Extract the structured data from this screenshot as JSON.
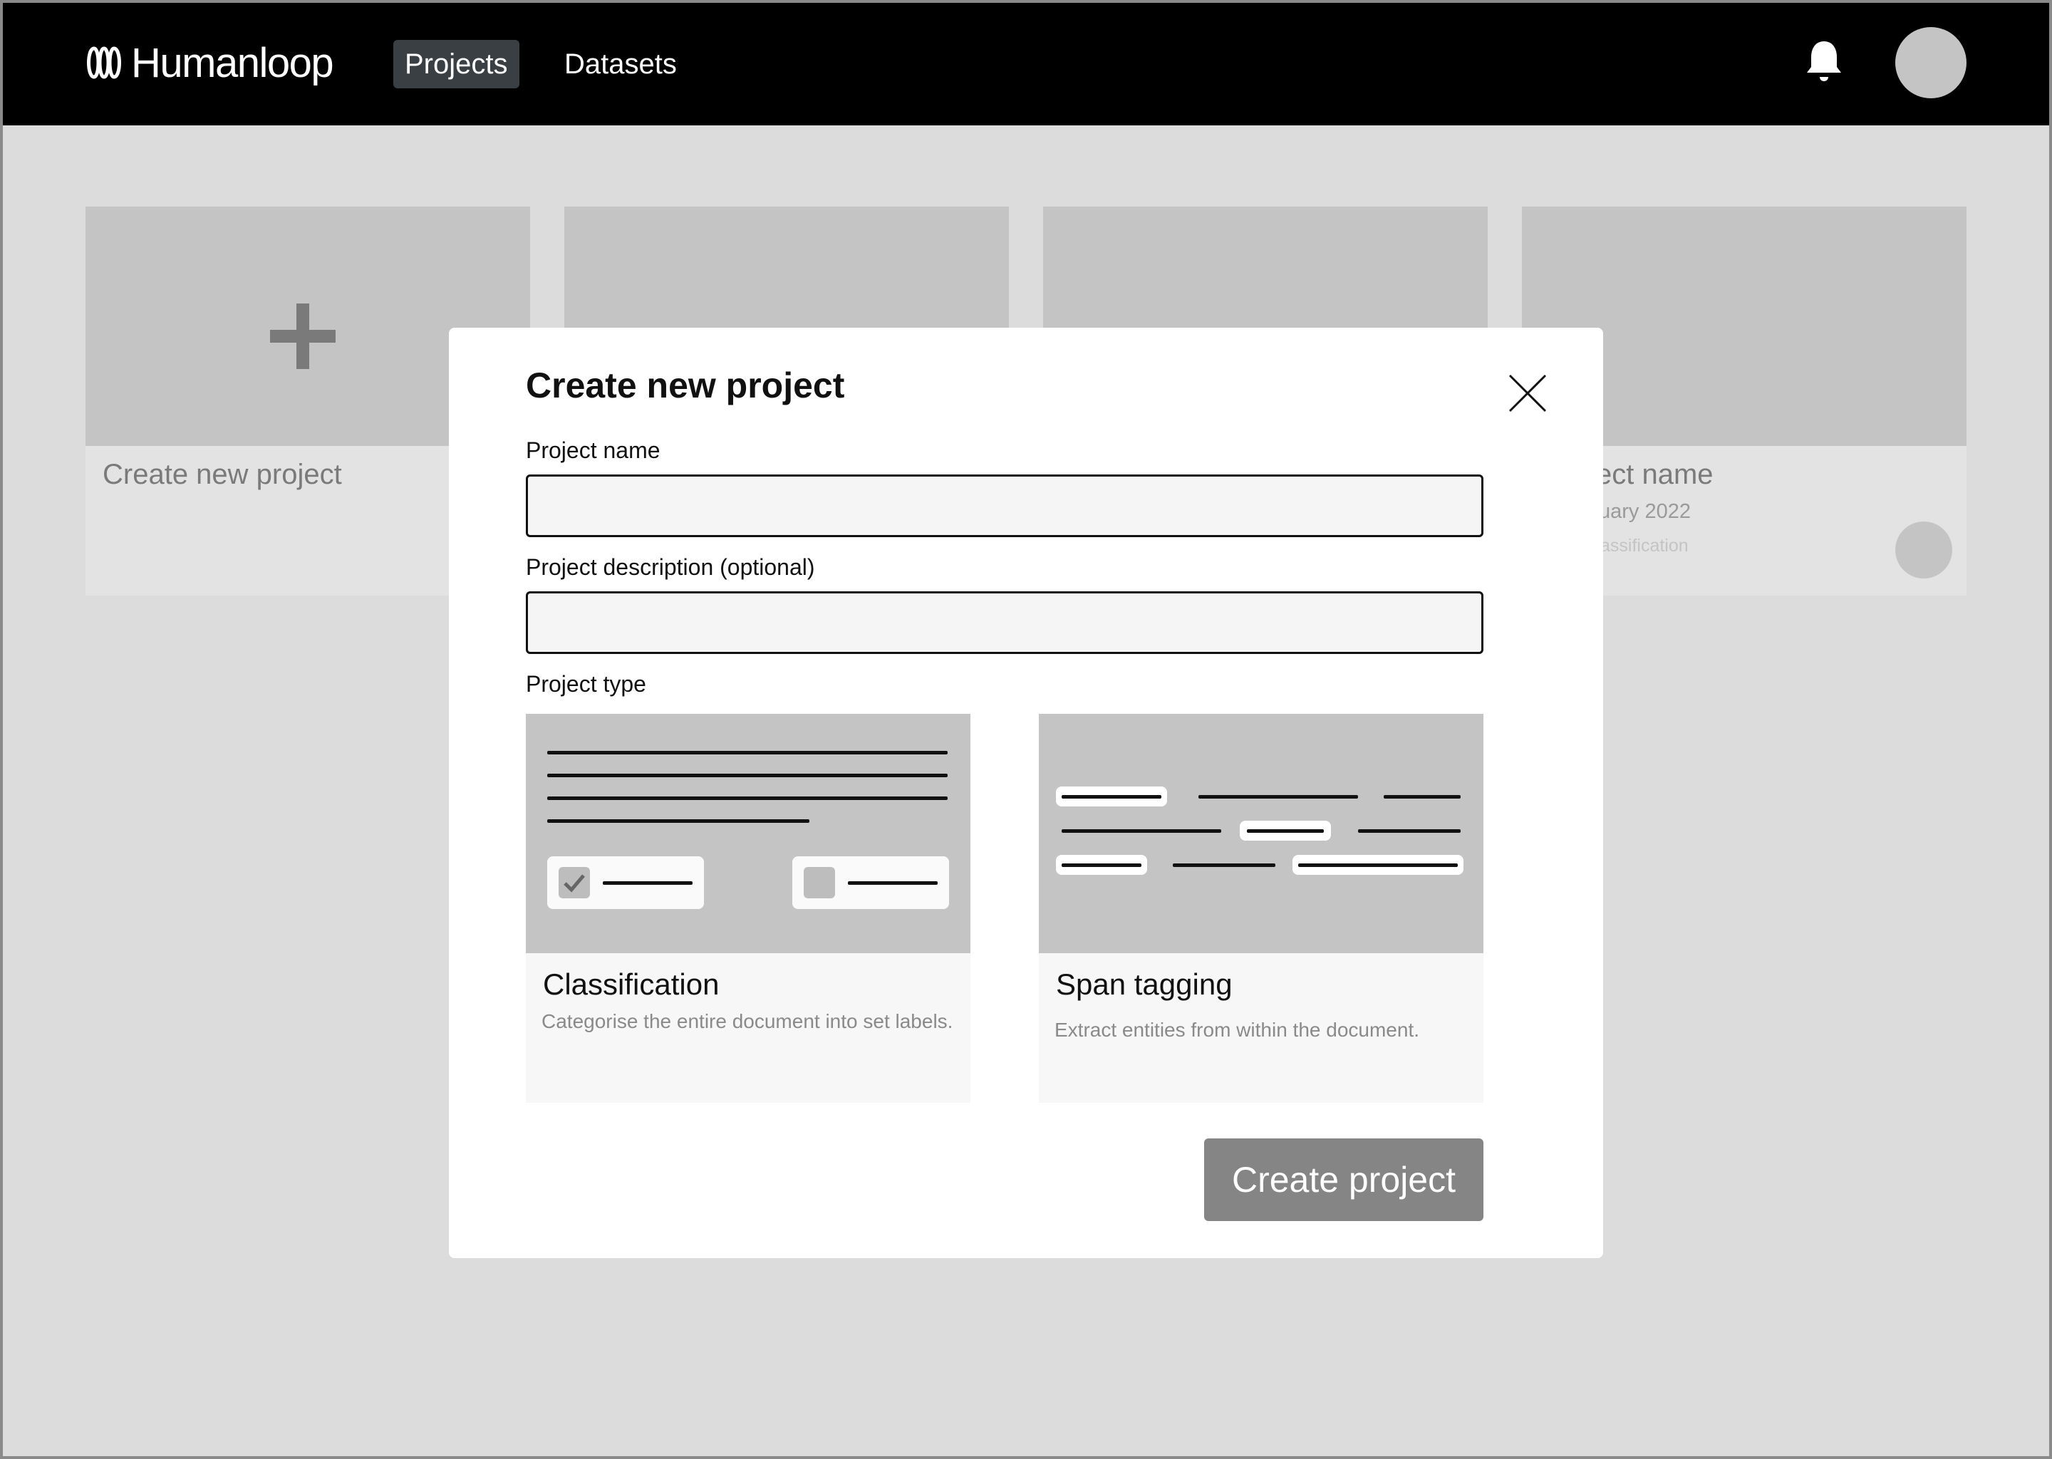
{
  "app": {
    "logo_text": "Humanloop",
    "nav": [
      {
        "label": "Projects",
        "active": true
      },
      {
        "label": "Datasets",
        "active": false
      }
    ],
    "icons": {
      "bell": "bell-icon",
      "avatar": "avatar"
    }
  },
  "background_cards": {
    "new_card_title": "Create new project",
    "project_card": {
      "title": "ect name",
      "date": "uary 2022",
      "type": "assification"
    }
  },
  "modal": {
    "title": "Create new project",
    "fields": {
      "name_label": "Project name",
      "name_value": "",
      "description_label": "Project description (optional)",
      "description_value": ""
    },
    "type_label": "Project type",
    "types": [
      {
        "title": "Classification",
        "description": "Categorise the entire document into set labels."
      },
      {
        "title": "Span tagging",
        "description": "Extract entities from within the document."
      }
    ],
    "submit_label": "Create project"
  },
  "colors": {
    "topbar": "#000000",
    "nav_active_bg": "#3a3f44",
    "page_bg": "#dcdcdc",
    "placeholder_grey": "#c4c4c4",
    "button_bg": "#858585"
  }
}
